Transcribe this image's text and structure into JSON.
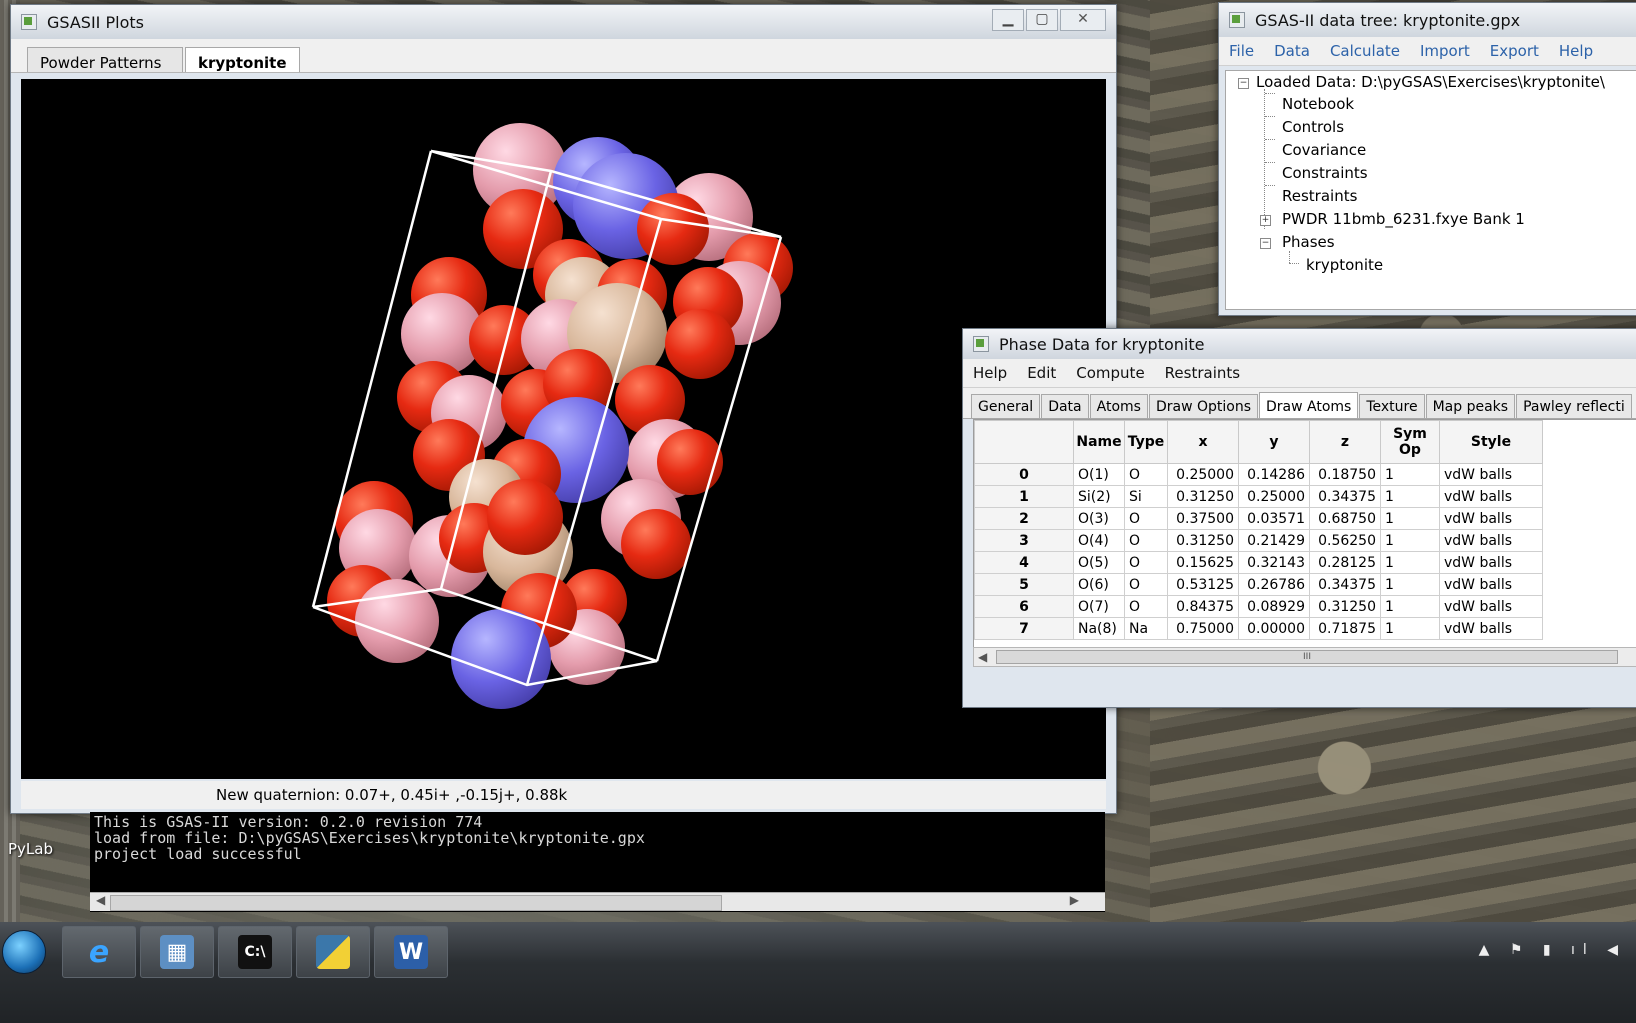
{
  "plots_window": {
    "title": "GSASII Plots",
    "tabs": [
      "Powder Patterns",
      "kryptonite"
    ],
    "status": "New quaternion: 0.07+, 0.45i+ ,-0.15j+, 0.88k"
  },
  "console": {
    "lines": [
      "This is GSAS-II version:      0.2.0  revision 774",
      "load from file:  D:\\pyGSAS\\Exercises\\kryptonite\\kryptonite.gpx",
      "project load successful"
    ]
  },
  "desktop": {
    "icon_label": "PyLab"
  },
  "tree_window": {
    "title": "GSAS-II data tree: kryptonite.gpx",
    "menu": [
      "File",
      "Data",
      "Calculate",
      "Import",
      "Export",
      "Help"
    ],
    "root": "Loaded Data: D:\\pyGSAS\\Exercises\\kryptonite\\",
    "items": [
      "Notebook",
      "Controls",
      "Covariance",
      "Constraints",
      "Restraints",
      "PWDR 11bmb_6231.fxye Bank 1",
      "Phases"
    ],
    "phase_child": "kryptonite"
  },
  "phase_window": {
    "title": "Phase Data for kryptonite",
    "menu": [
      "Help",
      "Edit",
      "Compute",
      "Restraints"
    ],
    "tabs": [
      "General",
      "Data",
      "Atoms",
      "Draw Options",
      "Draw Atoms",
      "Texture",
      "Map peaks",
      "Pawley reflecti"
    ],
    "active_tab": "Draw Atoms",
    "columns": [
      "Name",
      "Type",
      "x",
      "y",
      "z",
      "Sym Op",
      "Style"
    ],
    "rows": [
      {
        "idx": "0",
        "name": "O(1)",
        "type": "O",
        "x": "0.25000",
        "y": "0.14286",
        "z": "0.18750",
        "sym": "1",
        "style": "vdW balls"
      },
      {
        "idx": "1",
        "name": "Si(2)",
        "type": "Si",
        "x": "0.31250",
        "y": "0.25000",
        "z": "0.34375",
        "sym": "1",
        "style": "vdW balls"
      },
      {
        "idx": "2",
        "name": "O(3)",
        "type": "O",
        "x": "0.37500",
        "y": "0.03571",
        "z": "0.68750",
        "sym": "1",
        "style": "vdW balls"
      },
      {
        "idx": "3",
        "name": "O(4)",
        "type": "O",
        "x": "0.31250",
        "y": "0.21429",
        "z": "0.56250",
        "sym": "1",
        "style": "vdW balls"
      },
      {
        "idx": "4",
        "name": "O(5)",
        "type": "O",
        "x": "0.15625",
        "y": "0.32143",
        "z": "0.28125",
        "sym": "1",
        "style": "vdW balls"
      },
      {
        "idx": "5",
        "name": "O(6)",
        "type": "O",
        "x": "0.53125",
        "y": "0.26786",
        "z": "0.34375",
        "sym": "1",
        "style": "vdW balls"
      },
      {
        "idx": "6",
        "name": "O(7)",
        "type": "O",
        "x": "0.84375",
        "y": "0.08929",
        "z": "0.31250",
        "sym": "1",
        "style": "vdW balls"
      },
      {
        "idx": "7",
        "name": "Na(8)",
        "type": "Na",
        "x": "0.75000",
        "y": "0.00000",
        "z": "0.71875",
        "sym": "1",
        "style": "vdW balls"
      }
    ]
  },
  "colors": {
    "oxygen": "#e62a12",
    "silicon": "#e49cac",
    "sodium": "#6a63e4",
    "aluminium": "#d8b79b",
    "menu_link": "#2c62a9"
  }
}
